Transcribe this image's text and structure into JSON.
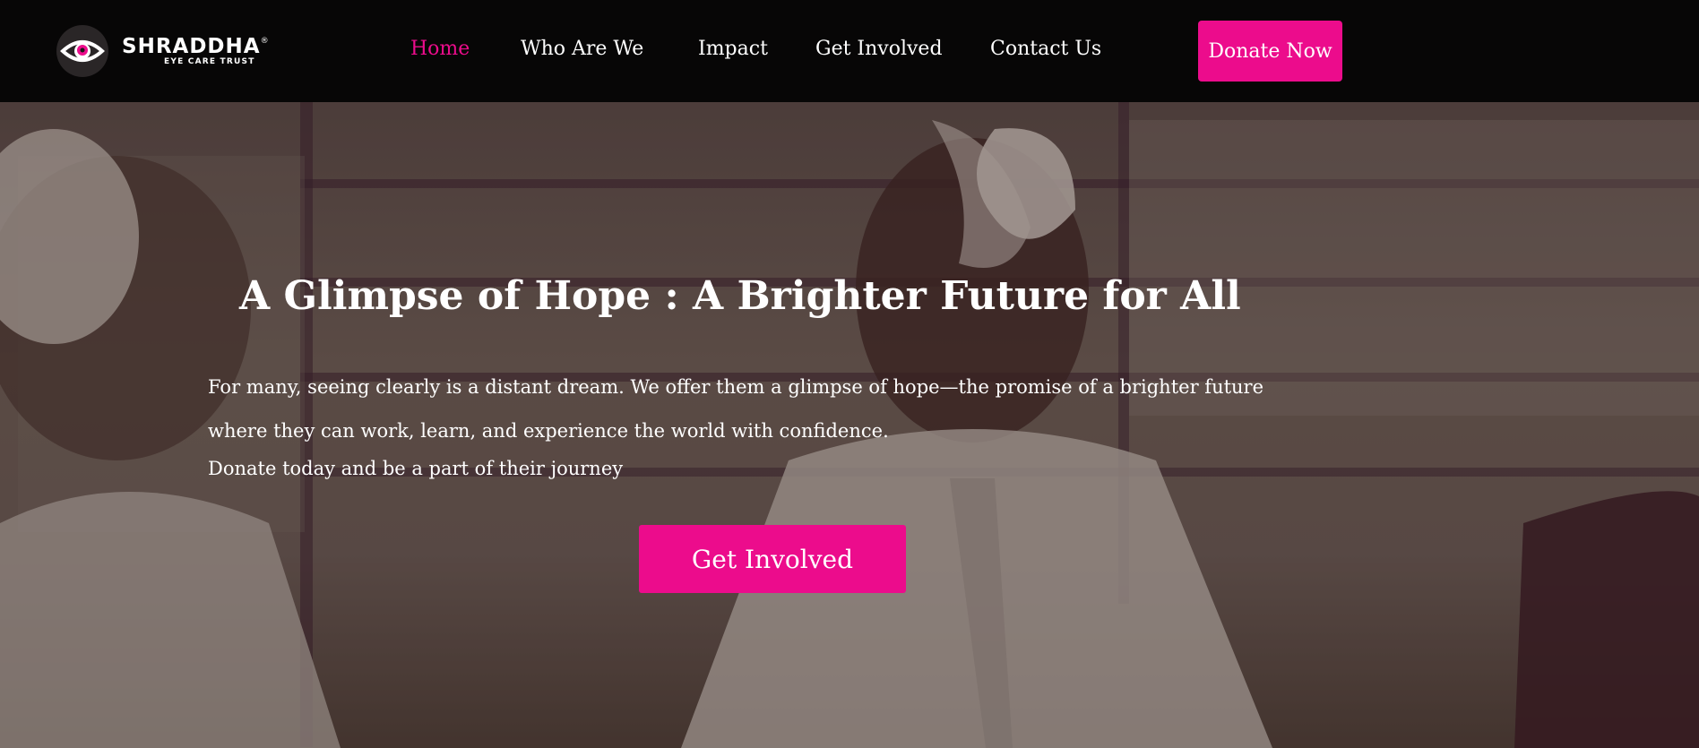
{
  "brand": {
    "name": "SHRADDHA",
    "registered_mark": "®",
    "tagline": "EYE CARE TRUST",
    "accent_color": "#ec0c8c"
  },
  "nav": {
    "items": [
      {
        "label": "Home",
        "active": true
      },
      {
        "label": "Who Are We",
        "active": false
      },
      {
        "label": "Impact",
        "active": false
      },
      {
        "label": "Get Involved",
        "active": false
      },
      {
        "label": "Contact Us",
        "active": false
      }
    ],
    "donate_label": "Donate Now"
  },
  "hero": {
    "title": "A Glimpse of Hope : A Brighter Future for All",
    "lines": [
      "For many, seeing clearly is a distant dream. We offer them a glimpse of hope—the promise of a brighter future",
      "where they can work, learn, and experience the world with confidence.",
      "Donate today and be a part of their journey"
    ],
    "cta_label": "Get Involved"
  }
}
